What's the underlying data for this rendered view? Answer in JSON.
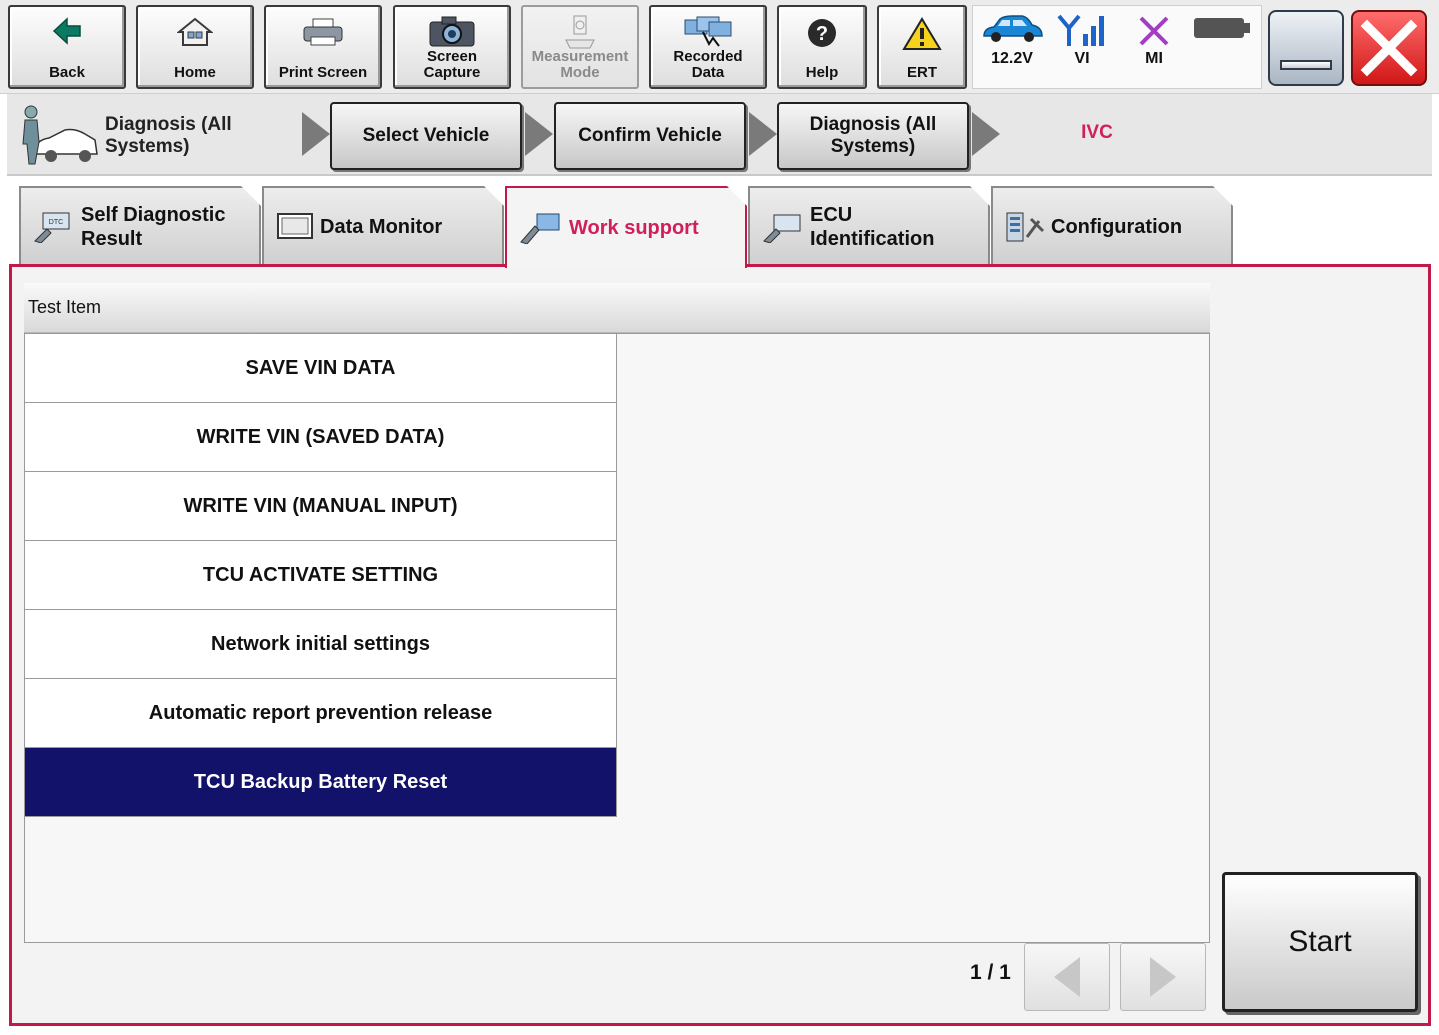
{
  "toolbar": {
    "back": "Back",
    "home": "Home",
    "print_screen": "Print Screen",
    "screen_capture": "Screen\nCapture",
    "measurement_mode": "Measurement\nMode",
    "recorded_data": "Recorded\nData",
    "help": "Help",
    "ert": "ERT"
  },
  "status": {
    "voltage": "12.2V",
    "vi": "VI",
    "mi": "MI"
  },
  "breadcrumb": {
    "title": "Diagnosis (All Systems)",
    "steps": [
      "Select Vehicle",
      "Confirm Vehicle",
      "Diagnosis (All Systems)"
    ],
    "current": "IVC"
  },
  "tabs": [
    {
      "label": "Self Diagnostic Result",
      "active": false
    },
    {
      "label": "Data Monitor",
      "active": false
    },
    {
      "label": "Work support",
      "active": true
    },
    {
      "label": "ECU Identification",
      "active": false
    },
    {
      "label": "Configuration",
      "active": false
    }
  ],
  "test_list": {
    "header": "Test Item",
    "items": [
      "SAVE VIN DATA",
      "WRITE VIN (SAVED DATA)",
      "WRITE VIN (MANUAL INPUT)",
      "TCU ACTIVATE SETTING",
      "Network initial settings",
      "Automatic report prevention release",
      "TCU Backup Battery Reset"
    ],
    "selected_index": 6
  },
  "pager": {
    "text": "1 / 1"
  },
  "start_button": "Start",
  "colors": {
    "accent": "#c4184a",
    "selected_row": "#12126b",
    "current_step": "#d0205a"
  }
}
